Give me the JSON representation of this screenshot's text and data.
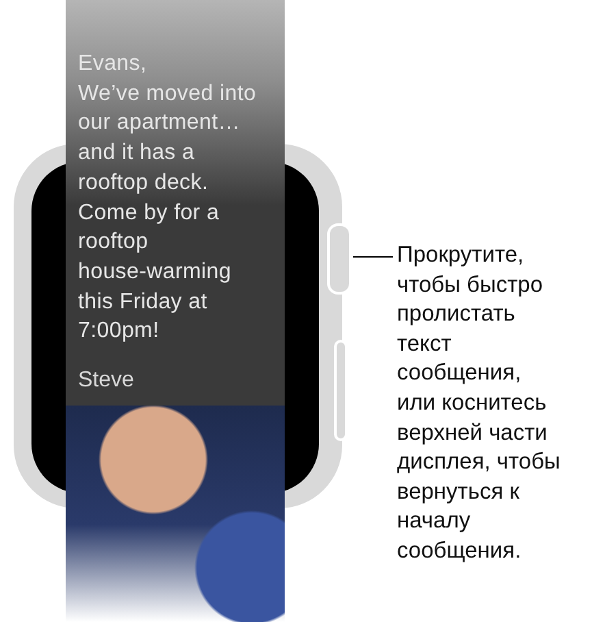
{
  "message": {
    "body": "Evans,\nWe’ve moved into\nour apartment…\nand it has a\nrooftop deck.\nCome by for a\nrooftop\nhouse-warming\nthis Friday at\n7:00pm!",
    "signature": "Steve"
  },
  "callout": {
    "text": "Прокрутите,\nчтобы быстро\nпролистать\nтекст\nсообщения,\nили коснитесь\nверхней части\nдисплея, чтобы\nвернуться к\nначалу\nсообщения."
  }
}
